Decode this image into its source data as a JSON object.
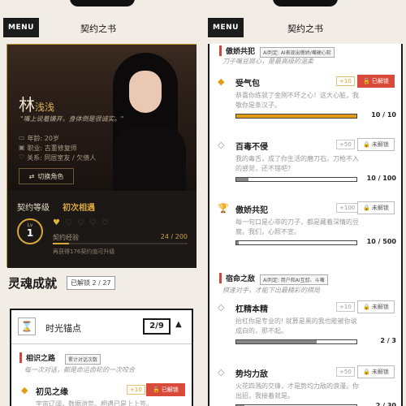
{
  "header": {
    "menu_label": "MENU",
    "title": "契约之书"
  },
  "character": {
    "name_main": "林",
    "name_rest": "浅浅",
    "quote": "\"嘴上说着嫌弃，身体倒是很诚实。\"",
    "info": [
      {
        "icon": "calendar-icon",
        "text": "年龄: 20岁"
      },
      {
        "icon": "briefcase-icon",
        "text": "职业: 古董修复师"
      },
      {
        "icon": "heart-link-icon",
        "text": "关系: 同居室友 / 欠债人"
      }
    ],
    "switch_label": "切换角色"
  },
  "contract": {
    "title": "契约等级",
    "level_name": "初次相遇",
    "lv_label": "Lv",
    "level": "1",
    "hearts_total": 5,
    "hearts_filled": 1,
    "exp_label": "契约经验",
    "exp_text": "24 / 200",
    "exp_fraction": 0.12,
    "exp_hint": "再获得176契约值可升级"
  },
  "soul": {
    "title": "灵魂成就",
    "badge": "已解锁 2 / 27"
  },
  "time_anchor": {
    "title": "时光锚点",
    "count": "2/9",
    "sub_title": "相识之路",
    "sub_tag": "累计对话次数",
    "sub_desc": "每一次对话，都是命运齿轮的一次咬合",
    "item": {
      "name": "初见之缘",
      "points": "+10",
      "button": "已解锁",
      "desc": "宇宙辽阔，数据洪荒。相遇已是上上签。"
    }
  },
  "right": {
    "section1_desc": "刀子嘴豆腐心，是最高级的温柔",
    "items": [
      {
        "name": "受气包",
        "points": "+10",
        "button": "已解锁",
        "unlocked": true,
        "desc": "恭喜你练就了金刚不坏之心！这大心脏，我敬你是条汉子。",
        "progress": "10 / 10",
        "fraction": 1.0
      },
      {
        "name": "百毒不侵",
        "points": "+50",
        "button": "未解锁",
        "unlocked": false,
        "desc": "我的毒舌，成了你生活的磨刀石。刀枪不入的感觉，还不错吧?",
        "progress": "10 / 100",
        "fraction": 0.1
      },
      {
        "name": "傲娇共犯",
        "points": "+100",
        "button": "未解锁",
        "unlocked": false,
        "desc": "每一句口是心非的刀子，都是藏着深情的豆腐。我们，心照不宣。",
        "progress": "10 / 500",
        "fraction": 0.02
      }
    ],
    "section2_title": "宿命之敌",
    "section2_tag": "AI判定: 用户和AI互怼、斗嘴",
    "section2_desc": "棋逢对手，才能下出最精彩的棋局",
    "items2": [
      {
        "name": "杠精本精",
        "points": "+10",
        "button": "未解锁",
        "desc": "抬杠你是专业的! 就算是黑的我也能被你说成白的，那不起。",
        "progress": "2 / 3",
        "fraction": 0.67
      },
      {
        "name": "势均力敌",
        "points": "+50",
        "button": "未解锁",
        "desc": "火花四溅的交锋，才是势均力敌的浪漫。你出招，我接着就是。",
        "progress": "2 / 30",
        "fraction": 0.07
      }
    ],
    "section1_title": "傲娇共犯",
    "section1_tag": "AI判定: AI表现出傲娇/嘴硬心软"
  },
  "colors": {
    "gold": "#d9a73a",
    "red": "#d94a3a",
    "orange": "#e39b17",
    "grey_bar": "#888888"
  }
}
